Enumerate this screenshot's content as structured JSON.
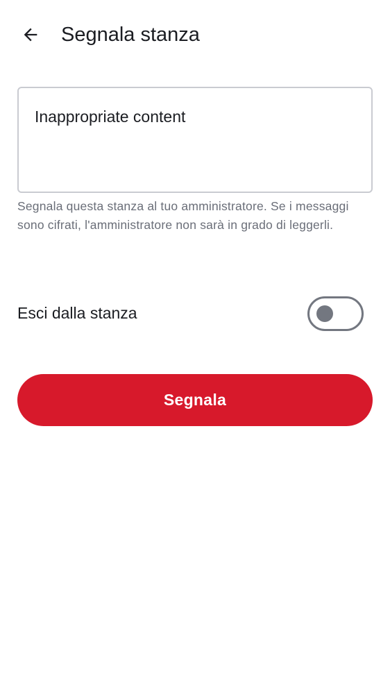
{
  "header": {
    "title": "Segnala stanza",
    "back_icon": "arrow-left-icon"
  },
  "reason": {
    "value": "Inappropriate content",
    "placeholder": ""
  },
  "helper": {
    "text": "Segnala questa stanza al tuo amministratore. Se i messaggi sono cifrati, l'amministratore non sarà in grado di leggerli."
  },
  "leave_room": {
    "label": "Esci dalla stanza",
    "enabled": false
  },
  "actions": {
    "report_label": "Segnala"
  },
  "colors": {
    "accent": "#d7192b",
    "toggle_off": "#737780",
    "text_primary": "#1b1d22",
    "text_secondary": "#6a6e78"
  }
}
